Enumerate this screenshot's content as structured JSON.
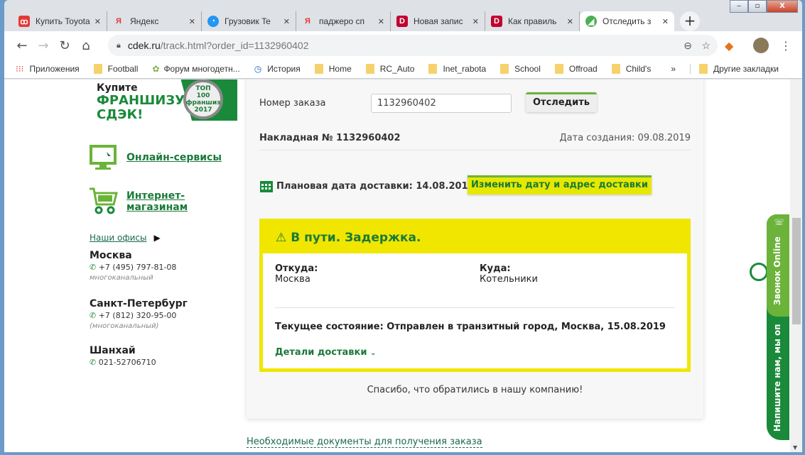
{
  "browser": {
    "tabs": [
      {
        "title": "Купить Toyota",
        "fav": "ꝏ",
        "color": "#e53935"
      },
      {
        "title": "Яндекс",
        "fav": "Я",
        "color": "#ffffff"
      },
      {
        "title": "Грузовик Te",
        "fav": "◔",
        "color": "#2196f3"
      },
      {
        "title": "паджеро сп",
        "fav": "Я",
        "color": "#ffffff"
      },
      {
        "title": "Новая запис",
        "fav": "D",
        "color": "#c2002f"
      },
      {
        "title": "Как правиль",
        "fav": "D",
        "color": "#c2002f"
      },
      {
        "title": "Отследить з",
        "fav": "◢",
        "color": "#4caf50"
      }
    ],
    "url_host": "cdek.ru",
    "url_path": "/track.html?order_id=1132960402",
    "bookmarks": [
      "Приложения",
      "Football",
      "Форум многодетн...",
      "История",
      "Home",
      "RC_Auto",
      "Inet_rabota",
      "School",
      "Offroad",
      "Child's"
    ],
    "other_bookmarks": "Другие закладки"
  },
  "sidebar": {
    "promo_line1": "Купите",
    "promo_line2": "ФРАНШИЗУ",
    "promo_line3": "СДЭК!",
    "badge": "ТОП 100 франшиз 2017",
    "online_services": "Онлайн-сервисы",
    "shops_1": "Интернет-",
    "shops_2": "магазинам",
    "offices_link": "Наши офисы",
    "offices": [
      {
        "city": "Москва",
        "phone": "+7 (495) 797-81-08",
        "note": "многоканальный"
      },
      {
        "city": "Санкт-Петербург",
        "phone": "+7 (812) 320-95-00",
        "note": "(многоканальный)"
      },
      {
        "city": "Шанхай",
        "phone": "021-52706710",
        "note": ""
      }
    ]
  },
  "tracking": {
    "order_label": "Номер заказа",
    "order_value": "1132960402",
    "track_button": "Отследить",
    "invoice": "Накладная № 1132960402",
    "created": "Дата создания: 09.08.2019",
    "planned": "Плановая дата доставки: 14.08.2019",
    "change_button": "Изменить дату и адрес доставки",
    "status": "В пути. Задержка.",
    "from_label": "Откуда:",
    "from_value": "Москва",
    "to_label": "Куда:",
    "to_value": "Котельники",
    "current": "Текущее состояние: Отправлен в транзитный город, Москва, 15.08.2019",
    "details": "Детали доставки",
    "thanks": "Спасибо, что обратились в нашу компанию!",
    "docs_link": "Необходимые документы для получения заказа"
  },
  "widgets": {
    "call": "Звонок Online",
    "chat": "Напишите нам, мы оп"
  },
  "colors": {
    "brand": "#1a8a3a",
    "accent": "#6bb33a",
    "status_bg": "#f0e600"
  }
}
